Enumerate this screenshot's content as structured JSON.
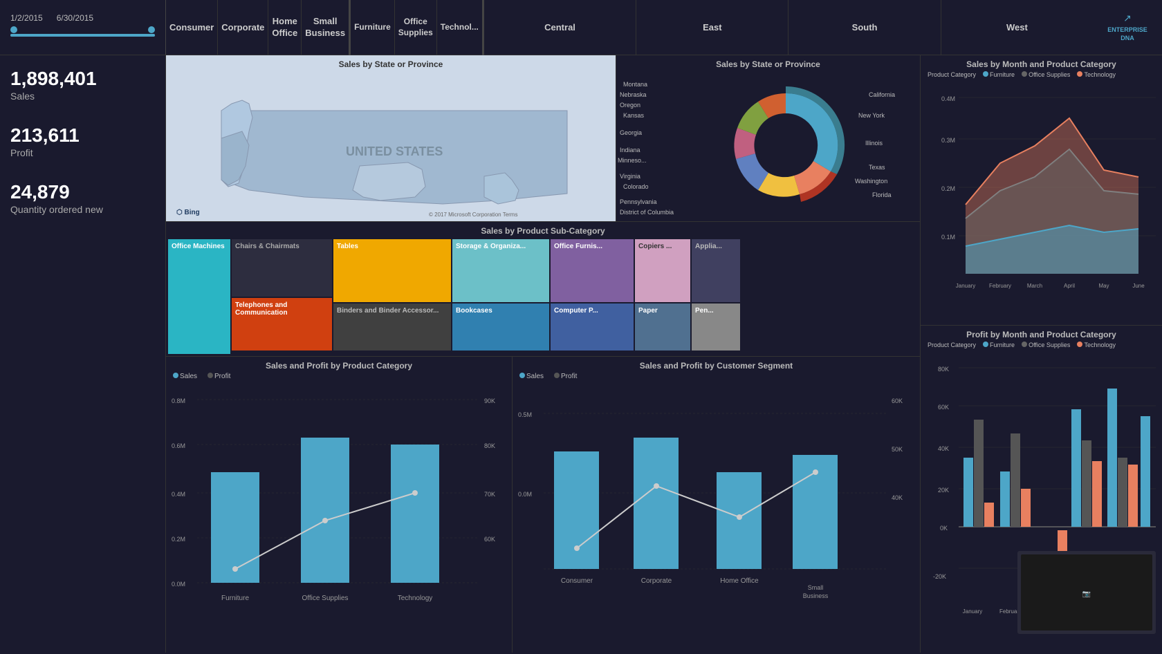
{
  "dates": {
    "start": "1/2/2015",
    "end": "6/30/2015"
  },
  "segments": [
    {
      "label": "Consumer"
    },
    {
      "label": "Corporate"
    },
    {
      "label": "Home Office"
    },
    {
      "label": "Small Business"
    }
  ],
  "categories": [
    {
      "label": "Furniture"
    },
    {
      "label": "Office Supplies"
    },
    {
      "label": "Technol..."
    }
  ],
  "regions": [
    {
      "label": "Central"
    },
    {
      "label": "East"
    },
    {
      "label": "South"
    },
    {
      "label": "West"
    }
  ],
  "kpis": [
    {
      "value": "1,898,401",
      "label": "Sales"
    },
    {
      "value": "213,611",
      "label": "Profit"
    },
    {
      "value": "24,879",
      "label": "Quantity ordered new"
    }
  ],
  "map_title": "Sales by State or Province",
  "donut_title": "Sales by State or Province",
  "treemap_title": "Sales by Product Sub-Category",
  "treemap_items": [
    {
      "label": "Office Machines",
      "color": "#2ab5c4",
      "size": 9
    },
    {
      "label": "Chairs & Chairmats",
      "color": "#2d2d3f",
      "size": 14
    },
    {
      "label": "Tables",
      "color": "#f0a800",
      "size": 12
    },
    {
      "label": "Storage & Organiza...",
      "color": "#6cc0c8",
      "size": 8
    },
    {
      "label": "Office Furnis...",
      "color": "#8060a0",
      "size": 6
    },
    {
      "label": "Copiers ...",
      "color": "#d0a0c0",
      "size": 4
    },
    {
      "label": "Applia...",
      "color": "#404060",
      "size": 4
    },
    {
      "label": "Telephones and Communication",
      "color": "#d04010",
      "size": 9
    },
    {
      "label": "Binders and Binder Accessor...",
      "color": "#404040",
      "size": 8
    },
    {
      "label": "Bookcases",
      "color": "#3080b0",
      "size": 6
    },
    {
      "label": "Computer P...",
      "color": "#4060a0",
      "size": 5
    },
    {
      "label": "Paper",
      "color": "#507090",
      "size": 4
    },
    {
      "label": "Pen...",
      "color": "#888",
      "size": 2
    }
  ],
  "sales_month_title": "Sales by Month and Product Category",
  "profit_month_title": "Profit by Month and Product Category",
  "product_legend": [
    {
      "label": "Furniture",
      "color": "#4da6c8"
    },
    {
      "label": "Office Supplies",
      "color": "#666"
    },
    {
      "label": "Technology",
      "color": "#e88060"
    }
  ],
  "months": [
    "January",
    "February",
    "March",
    "April",
    "May",
    "June"
  ],
  "bottom_left_title": "Sales and Profit by Product Category",
  "bottom_right_title": "Sales and Profit by Customer Segment",
  "bar_legend": [
    {
      "label": "Sales",
      "color": "#4da6c8"
    },
    {
      "label": "Profit",
      "color": "#555"
    }
  ],
  "bottom_left_categories": [
    "Furniture",
    "Office Supplies",
    "Technology"
  ],
  "bottom_right_segments": [
    "Consumer",
    "Corporate",
    "Home Office",
    "Small Business"
  ],
  "logo_line1": "ENTERPRISE",
  "logo_line2": "DNA"
}
